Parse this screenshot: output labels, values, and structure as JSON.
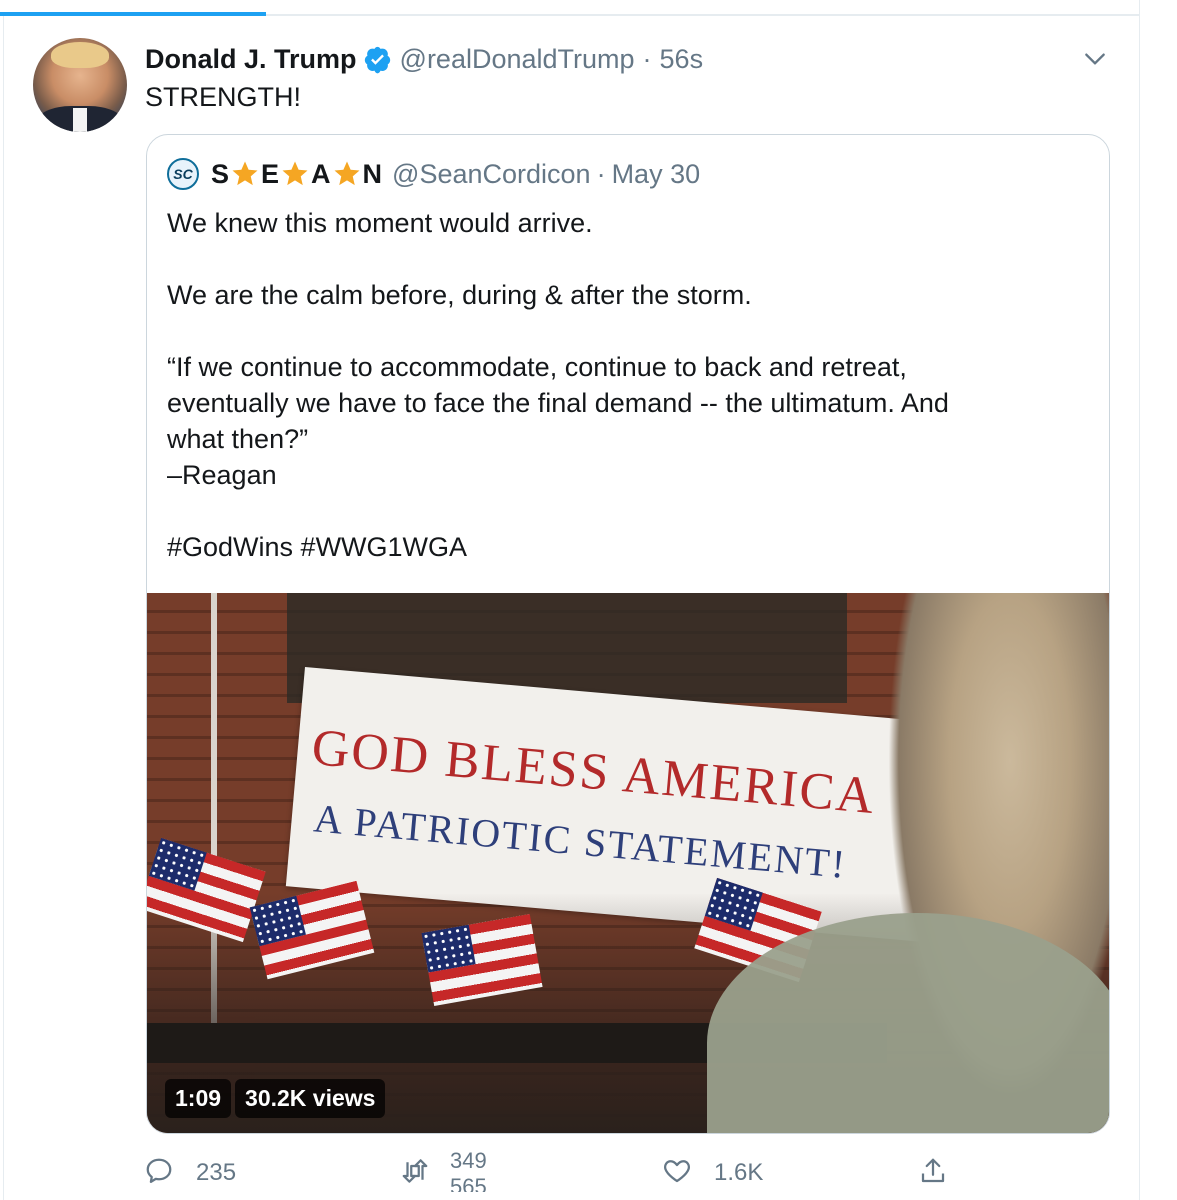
{
  "tweet": {
    "author_name": "Donald J. Trump",
    "handle": "@realDonaldTrump",
    "separator": "·",
    "time": "56s",
    "text": "STRENGTH!",
    "verified": true
  },
  "quote": {
    "avatar_initials": "SC",
    "name_letters": [
      "S",
      "E",
      "A",
      "N"
    ],
    "handle": "@SeanCordicon",
    "separator": "·",
    "date": "May 30",
    "lines": {
      "l1": "We knew this moment would arrive.",
      "l2": "We are the calm before, during & after the storm.",
      "l3": "“If we continue to accommodate, continue to back and retreat,",
      "l4": "eventually we have to face the final demand -- the ultimatum. And",
      "l5": "what then?”",
      "l6": "–Reagan",
      "l7": "#GodWins #WWG1WGA"
    },
    "media": {
      "banner_line1": "GOD BLESS AMERICA",
      "banner_line2": "A PATRIOTIC STATEMENT!",
      "duration": "1:09",
      "views": "30.2K views"
    }
  },
  "actions": {
    "replies": "235",
    "retweets_top": "349",
    "retweets_bottom": "565",
    "likes": "1.6K"
  },
  "colors": {
    "accent": "#1da1f2",
    "text_primary": "#14171a",
    "text_secondary": "#657786",
    "border": "#ccd6dd",
    "star": "#f5a623"
  },
  "icons": {
    "verified": "verified-badge-icon",
    "more": "chevron-down-icon",
    "reply": "reply-icon",
    "retweet": "retweet-icon",
    "like": "heart-icon",
    "share": "share-icon",
    "star": "star-icon"
  }
}
